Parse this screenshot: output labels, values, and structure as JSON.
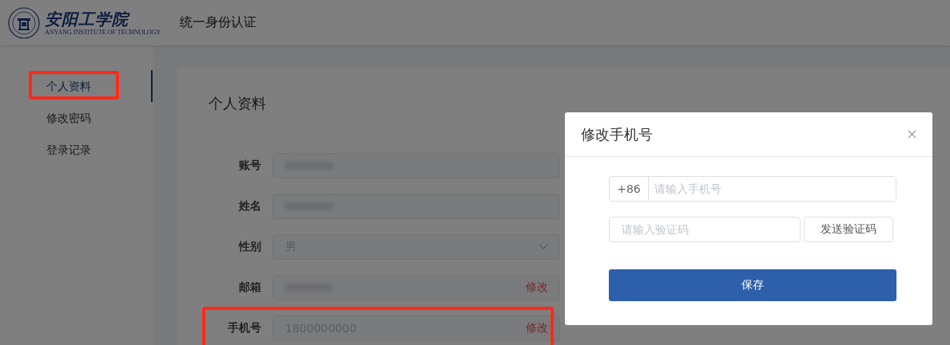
{
  "header": {
    "logo": {
      "name": "安阳工学院",
      "subtitle": "ANYANG INSTITUTE OF TECHNOLOGY"
    },
    "title": "统一身份认证"
  },
  "sidebar": {
    "items": [
      {
        "label": "个人资料",
        "selected": true,
        "highlighted": true
      },
      {
        "label": "修改密码",
        "selected": false,
        "highlighted": false
      },
      {
        "label": "登录记录",
        "selected": false,
        "highlighted": false
      }
    ]
  },
  "profile": {
    "title": "个人资料",
    "fields": [
      {
        "label": "账号",
        "kind": "redacted",
        "highlighted": false
      },
      {
        "label": "姓名",
        "kind": "redacted",
        "highlighted": false
      },
      {
        "label": "性别",
        "kind": "select",
        "value": "男",
        "highlighted": false
      },
      {
        "label": "邮箱",
        "kind": "redacted",
        "action": "修改",
        "highlighted": false
      },
      {
        "label": "手机号",
        "kind": "text",
        "value": "1800000000",
        "action": "修改",
        "highlighted": true
      }
    ]
  },
  "dialog": {
    "title": "修改手机号",
    "prefix": "+86",
    "phone_placeholder": "请输入手机号",
    "code_placeholder": "请输入验证码",
    "send_button": "发送验证码",
    "save_button": "保存"
  }
}
